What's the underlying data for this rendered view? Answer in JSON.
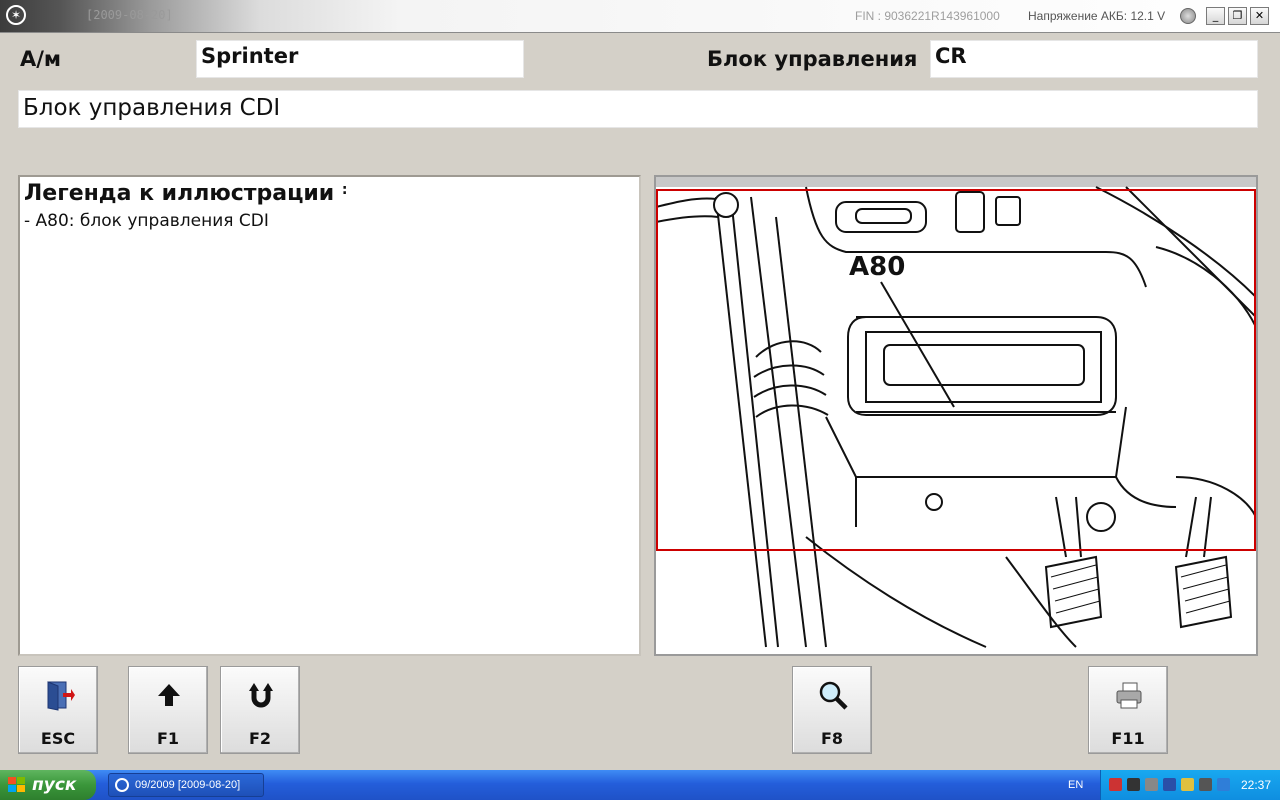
{
  "titlebar": {
    "title": "[2009-08-20]",
    "fin": "FIN : 9036221R143961000",
    "battery_voltage": "Напряжение АКБ: 12.1 V"
  },
  "form": {
    "vehicle_label": "А/м",
    "vehicle_value": "Sprinter",
    "control_unit_label": "Блок управления",
    "control_unit_value": "CR",
    "description": "Блок управления CDI"
  },
  "legend": {
    "title": "Легенда к иллюстрации",
    "title_suffix": ":",
    "items": [
      "- A80: блок управления CDI"
    ]
  },
  "illustration": {
    "callout": "A80",
    "highlight_color": "#cc0000"
  },
  "buttons": [
    {
      "key": "ESC",
      "icon": "exit-door-icon"
    },
    {
      "key": "F1",
      "icon": "arrow-up-icon"
    },
    {
      "key": "F2",
      "icon": "u-turn-icon"
    },
    {
      "key": "F8",
      "icon": "magnifier-icon"
    },
    {
      "key": "F11",
      "icon": "printer-icon"
    }
  ],
  "taskbar": {
    "start_label": "пуск",
    "task_label": "09/2009 [2009-08-20]",
    "language": "EN",
    "clock": "22:37"
  }
}
